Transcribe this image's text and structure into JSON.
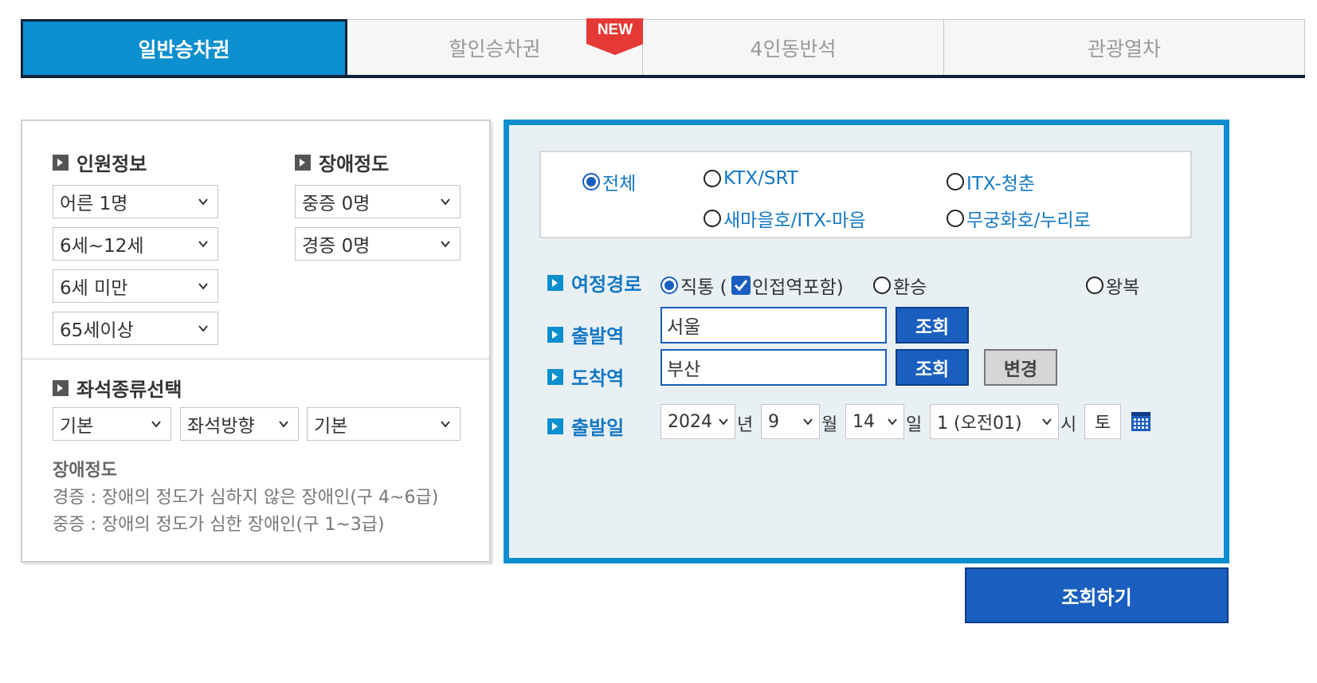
{
  "tabs": [
    {
      "label": "일반승차권",
      "active": true
    },
    {
      "label": "할인승차권",
      "badge": "NEW"
    },
    {
      "label": "4인동반석"
    },
    {
      "label": "관광열차"
    }
  ],
  "passengers": {
    "title": "인원정보",
    "options": [
      "어른 1명",
      "6세~12세",
      "6세 미만",
      "65세이상"
    ]
  },
  "disability": {
    "title": "장애정도",
    "options": [
      "중증 0명",
      "경증 0명"
    ]
  },
  "seat": {
    "title": "좌석종류선택",
    "options": [
      "기본",
      "좌석방향",
      "기본"
    ]
  },
  "notes": {
    "title": "장애정도",
    "lines": [
      "경증 : 장애의 정도가 심하지 않은 장애인(구 4~6급)",
      "중증 : 장애의 정도가 심한 장애인(구 1~3급)"
    ]
  },
  "train_types": [
    {
      "label": "전체",
      "checked": true
    },
    {
      "label": "KTX/SRT",
      "checked": false
    },
    {
      "label": "ITX-청춘",
      "checked": false
    },
    {
      "label": "새마을호/ITX-마음",
      "checked": false
    },
    {
      "label": "무궁화호/누리로",
      "checked": false
    }
  ],
  "route": {
    "label": "여정경로",
    "direct": "직통 (",
    "adjacent": "인접역포함)",
    "transfer": "환승",
    "roundtrip": "왕복"
  },
  "departure": {
    "label": "출발역",
    "value": "서울",
    "button": "조회"
  },
  "arrival": {
    "label": "도착역",
    "value": "부산",
    "button": "조회",
    "swap": "변경"
  },
  "date": {
    "label": "출발일",
    "year": "2024",
    "year_unit": "년",
    "month": "9",
    "month_unit": "월",
    "day": "14",
    "day_unit": "일",
    "hour": "1 (오전01)",
    "hour_unit": "시",
    "weekday": "토"
  },
  "search_button": "조회하기",
  "colors": {
    "primary": "#0c8fce",
    "button": "#1a5fbf",
    "navy": "#0e2238",
    "badge": "#e53935"
  }
}
